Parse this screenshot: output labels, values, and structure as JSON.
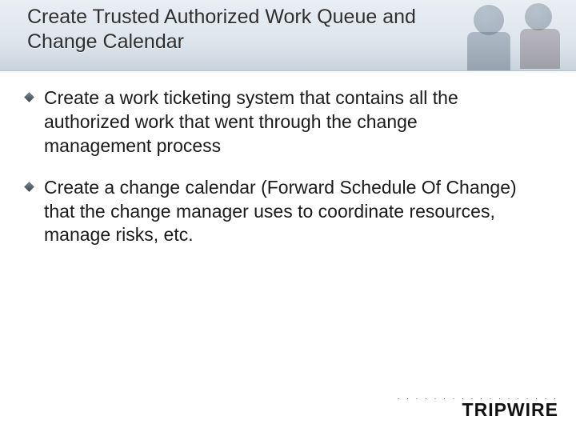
{
  "title": "Create Trusted Authorized Work Queue and Change Calendar",
  "bullets": [
    "Create a work ticketing system that contains all the authorized work that went through the change management process",
    "Create a change calendar (Forward Schedule Of Change) that the change manager uses to coordinate resources, manage risks, etc."
  ],
  "footer": {
    "logo_text": "TRIPWIRE"
  }
}
